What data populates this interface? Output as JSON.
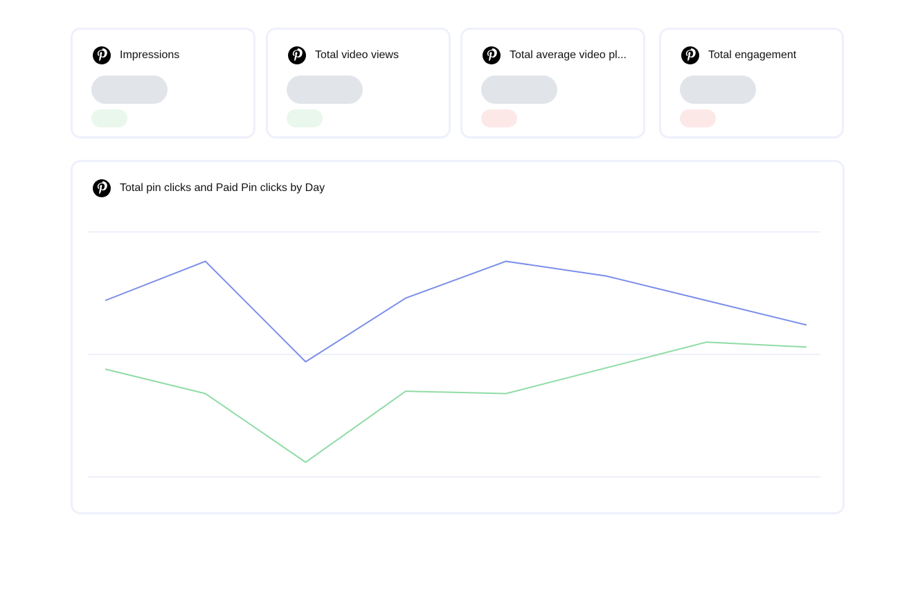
{
  "colors": {
    "card_border": "#eef0fb",
    "skeleton_value": "#e1e5ea",
    "delta_positive": "#eaf7ec",
    "delta_negative": "#fde8e8",
    "series_1": "#7b8ee8",
    "series_2": "#8fdca5",
    "grid": "#eef0fb"
  },
  "kpi_cards": [
    {
      "title": "Impressions",
      "icon": "pinterest-logo-icon",
      "delta_status": "positive"
    },
    {
      "title": "Total video views",
      "icon": "pinterest-logo-icon",
      "delta_status": "positive"
    },
    {
      "title": "Total average video pl...",
      "icon": "pinterest-logo-icon",
      "delta_status": "negative"
    },
    {
      "title": "Total engagement",
      "icon": "pinterest-logo-icon",
      "delta_status": "negative"
    }
  ],
  "chart_card": {
    "icon": "pinterest-logo-icon",
    "title": "Total pin clicks and Paid Pin clicks by Day"
  },
  "chart_data": {
    "type": "line",
    "title": "Total pin clicks and Paid Pin clicks by Day",
    "xlabel": "",
    "ylabel": "",
    "x": [
      1,
      2,
      3,
      4,
      5,
      6,
      7,
      8
    ],
    "ylim": [
      0,
      100
    ],
    "grid": true,
    "legend": "none",
    "series": [
      {
        "values": [
          72,
          88,
          47,
          73,
          88,
          82,
          null,
          62
        ]
      },
      {
        "values": [
          44,
          34,
          6,
          35,
          34,
          null,
          55,
          53
        ]
      }
    ]
  }
}
